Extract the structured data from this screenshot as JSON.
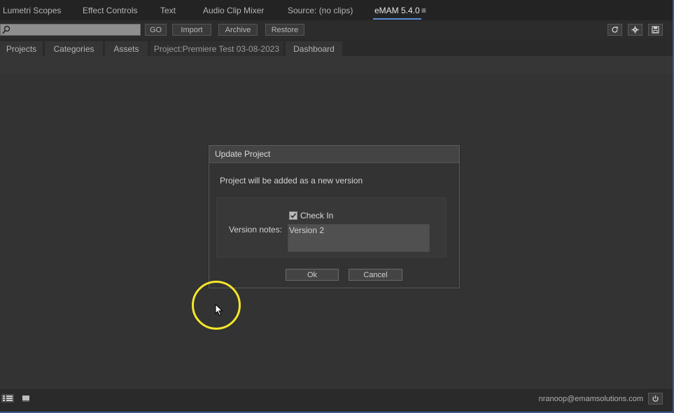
{
  "panel_tabs": {
    "lumetri": "Lumetri Scopes",
    "effect_controls": "Effect Controls",
    "text": "Text",
    "audio_clip_mixer": "Audio Clip Mixer",
    "source": "Source: (no clips)",
    "emam": "eMAM 5.4.0",
    "menu_glyph": "≡"
  },
  "toolbar": {
    "search_value": "",
    "go": "GO",
    "import": "Import",
    "archive": "Archive",
    "restore": "Restore",
    "icons": [
      "refresh-icon",
      "gear-icon",
      "save-icon"
    ]
  },
  "subtabs": {
    "projects": "Projects",
    "categories": "Categories",
    "assets": "Assets",
    "project": "Project:Premiere Test 03-08-2023",
    "dashboard": "Dashboard"
  },
  "dialog": {
    "title": "Update Project",
    "message": "Project will be added as a new version",
    "check_in_label": "Check In",
    "check_in_checked": true,
    "notes_label": "Version notes:",
    "notes_value": "Version 2",
    "ok": "Ok",
    "cancel": "Cancel"
  },
  "status": {
    "email": "nranoop@emamsolutions.com"
  },
  "colors": {
    "accent": "#5a8dd6",
    "cursor_highlight": "#f4e62a",
    "background": "#333333"
  }
}
